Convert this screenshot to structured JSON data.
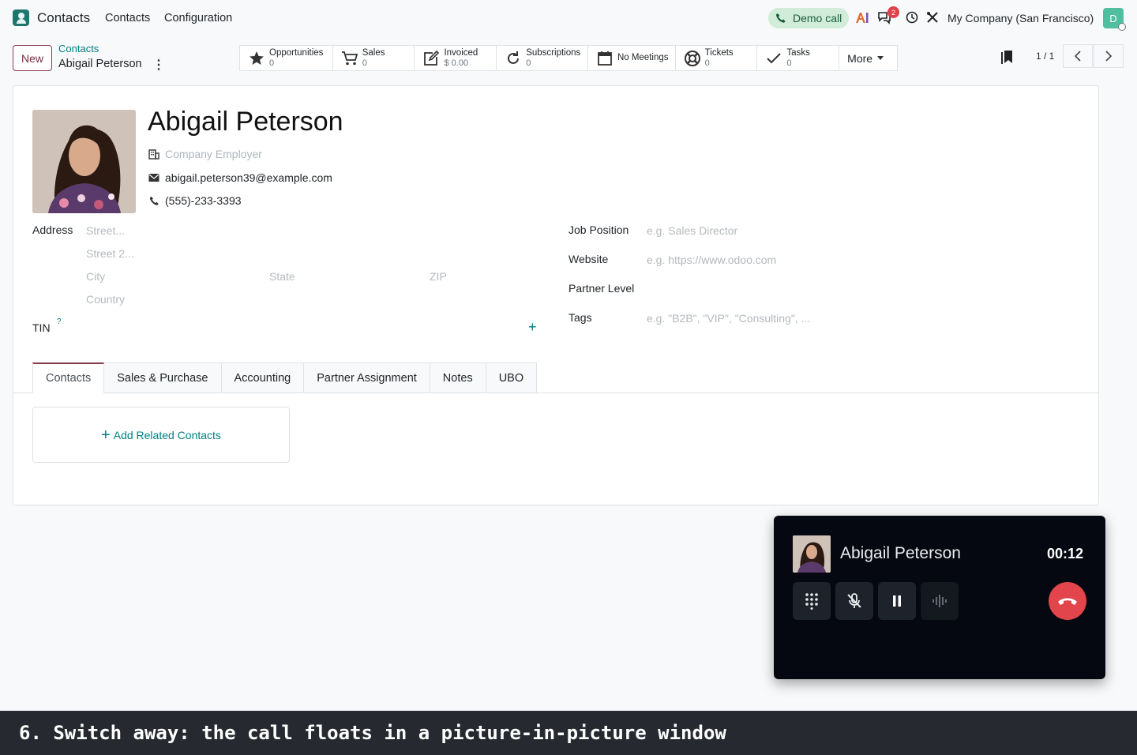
{
  "topnav": {
    "app_name": "Contacts",
    "menus": [
      "Contacts",
      "Configuration"
    ],
    "demo_call_label": "Demo call",
    "messages_badge": "2",
    "company": "My Company (San Francisco)",
    "user_initial": "D"
  },
  "control": {
    "new_label": "New",
    "breadcrumb_parent": "Contacts",
    "breadcrumb_current": "Abigail Peterson",
    "pager": "1 / 1"
  },
  "smart_buttons": [
    {
      "label": "Opportunities",
      "value": "0",
      "icon": "star-icon"
    },
    {
      "label": "Sales",
      "value": "0",
      "icon": "cart-icon"
    },
    {
      "label": "Invoiced",
      "value": "$ 0.00",
      "icon": "edit-icon"
    },
    {
      "label": "Subscriptions",
      "value": "0",
      "icon": "refresh-icon"
    },
    {
      "label": "No Meetings",
      "value": "",
      "icon": "calendar-icon"
    },
    {
      "label": "Tickets",
      "value": "0",
      "icon": "lifebuoy-icon"
    },
    {
      "label": "Tasks",
      "value": "0",
      "icon": "check-icon"
    }
  ],
  "more_label": "More",
  "form": {
    "name": "Abigail Peterson",
    "company_placeholder": "Company Employer",
    "email": "abigail.peterson39@example.com",
    "phone": "(555)-233-3393",
    "address_label": "Address",
    "street_ph": "Street...",
    "street2_ph": "Street 2...",
    "city_ph": "City",
    "state_ph": "State",
    "zip_ph": "ZIP",
    "country_ph": "Country",
    "tin_label": "TIN",
    "tin_help": "?",
    "job_label": "Job Position",
    "job_ph": "e.g. Sales Director",
    "website_label": "Website",
    "website_ph": "e.g. https://www.odoo.com",
    "partner_level_label": "Partner Level",
    "tags_label": "Tags",
    "tags_ph": "e.g. \"B2B\", \"VIP\", \"Consulting\", ..."
  },
  "tabs": [
    {
      "label": "Contacts",
      "active": true
    },
    {
      "label": "Sales & Purchase"
    },
    {
      "label": "Accounting"
    },
    {
      "label": "Partner Assignment"
    },
    {
      "label": "Notes"
    },
    {
      "label": "UBO"
    }
  ],
  "add_related_label": "Add Related Contacts",
  "call": {
    "name": "Abigail Peterson",
    "timer": "00:12"
  },
  "caption": "6. Switch away: the call floats in a picture-in-picture window",
  "colors": {
    "accent": "#017e84",
    "primary": "#8b3a4e",
    "hangup": "#e2454b"
  }
}
